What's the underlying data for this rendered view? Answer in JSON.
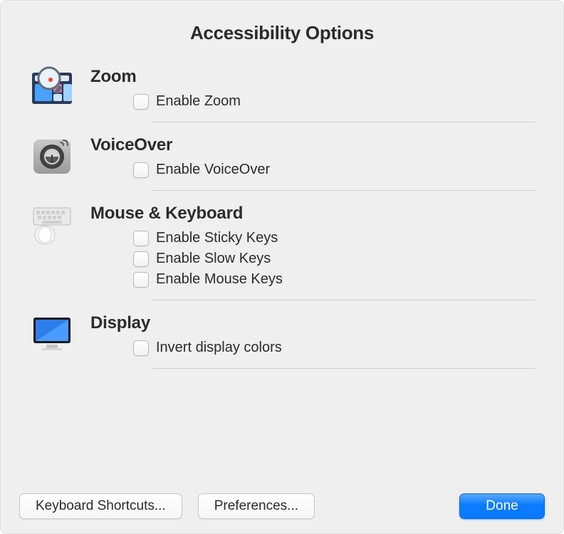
{
  "title": "Accessibility Options",
  "sections": {
    "zoom": {
      "heading": "Zoom",
      "options": {
        "enable_zoom": "Enable Zoom"
      }
    },
    "voiceover": {
      "heading": "VoiceOver",
      "options": {
        "enable_voiceover": "Enable VoiceOver"
      }
    },
    "mousekeyboard": {
      "heading": "Mouse & Keyboard",
      "options": {
        "sticky": "Enable Sticky Keys",
        "slow": "Enable Slow Keys",
        "mouse": "Enable Mouse Keys"
      }
    },
    "display": {
      "heading": "Display",
      "options": {
        "invert": "Invert display colors"
      }
    }
  },
  "footer": {
    "keyboard_shortcuts": "Keyboard Shortcuts...",
    "preferences": "Preferences...",
    "done": "Done"
  }
}
